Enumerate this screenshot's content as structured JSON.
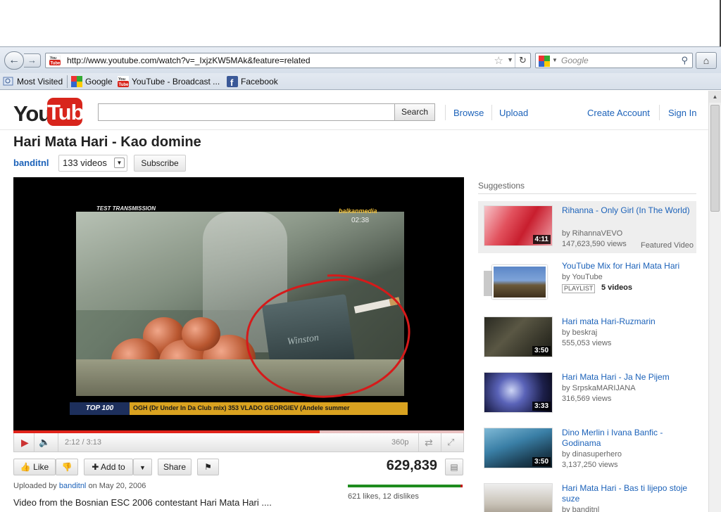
{
  "browser": {
    "url": "http://www.youtube.com/watch?v=_IxjzKW5MAk&feature=related",
    "search_placeholder": "Google",
    "bookmarks": [
      {
        "label": "Most Visited",
        "icon": "most-visited-icon"
      },
      {
        "label": "Google",
        "icon": "google-icon"
      },
      {
        "label": "YouTube - Broadcast ...",
        "icon": "youtube-icon"
      },
      {
        "label": "Facebook",
        "icon": "facebook-icon"
      }
    ]
  },
  "header": {
    "logo_you": "You",
    "logo_tube": "Tube",
    "search_button": "Search",
    "links": {
      "browse": "Browse",
      "upload": "Upload",
      "create_account": "Create Account",
      "sign_in": "Sign In"
    }
  },
  "video": {
    "title": "Hari Mata Hari - Kao domine",
    "channel": "banditnl",
    "video_count": "133 videos",
    "subscribe": "Subscribe",
    "overlay": {
      "test_transmission": "TEST TRANSMISSION",
      "broadcaster": "balkanmedia",
      "clock": "02:38",
      "ticker_tag": "TOP 100",
      "ticker_text": "OGH (Dr Under In Da Club mix)     353 VLADO GEORGIEV (Andele summer"
    },
    "pack_text": "Winston",
    "progress": {
      "played_fraction": 0.68
    },
    "timer": "2:12 / 3:13",
    "quality": "360p",
    "actions": {
      "like": "Like",
      "add_to": "Add to",
      "share": "Share"
    },
    "views": "629,839",
    "uploaded_prefix": "Uploaded by",
    "uploader": "banditnl",
    "uploaded_date": "on May 20, 2006",
    "likes_text": "621 likes, 12 dislikes",
    "like_fraction": 0.98,
    "description": "Video from the Bosnian ESC 2006 contestant Hari Mata Hari ...."
  },
  "suggestions": {
    "heading": "Suggestions",
    "items": [
      {
        "title": "Rihanna - Only Girl (In The World)",
        "by": "by RihannaVEVO",
        "views": "147,623,590 views",
        "duration": "4:11",
        "featured": "Featured Video"
      },
      {
        "title": "YouTube Mix for Hari Mata Hari",
        "by": "by YouTube",
        "badge": "PLAYLIST",
        "count": "5 videos"
      },
      {
        "title": "Hari mata Hari-Ruzmarin",
        "by": "by beskraj",
        "views": "555,053 views",
        "duration": "3:50"
      },
      {
        "title": "Hari Mata Hari - Ja Ne Pijem",
        "by": "by SrpskaMARIJANA",
        "views": "316,569 views",
        "duration": "3:33"
      },
      {
        "title": "Dino Merlin i Ivana Banfic - Godinama",
        "by": "by dinasuperhero",
        "views": "3,137,250 views",
        "duration": "3:50"
      },
      {
        "title": "Hari Mata Hari - Bas ti lijepo stoje suze",
        "by": "by banditnl"
      }
    ]
  },
  "colors": {
    "link": "#1c62b9",
    "youtube_red": "#d8251c",
    "like_green": "#1e8c1e",
    "dislike_red": "#c4151b"
  }
}
